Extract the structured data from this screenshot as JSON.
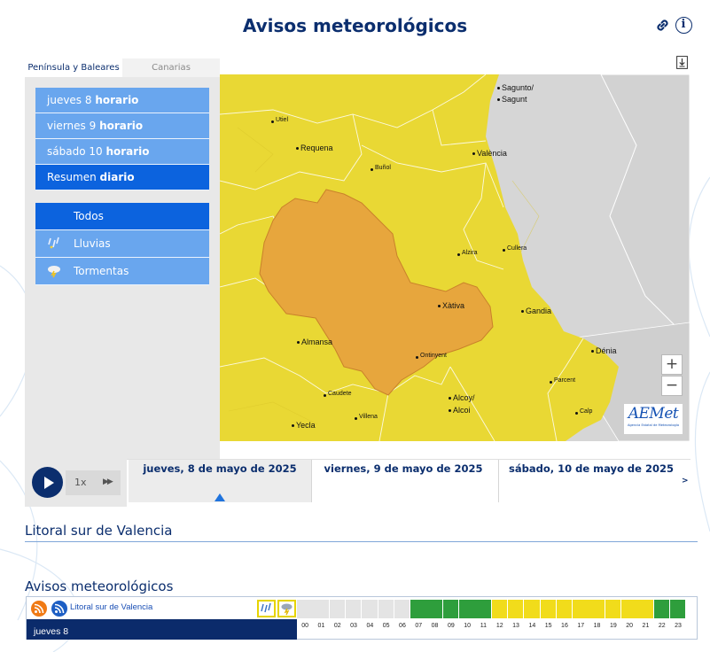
{
  "header": {
    "title": "Avisos meteorológicos",
    "link_icon": "link-icon",
    "info_icon": "info-icon",
    "info_glyph": "i"
  },
  "tabs": [
    {
      "label": "Península y Baleares",
      "active": true
    },
    {
      "label": "Canarias",
      "active": false
    }
  ],
  "days": [
    {
      "prefix": "jueves 8",
      "bold": "horario",
      "selected": false
    },
    {
      "prefix": "viernes 9",
      "bold": "horario",
      "selected": false
    },
    {
      "prefix": "sábado 10",
      "bold": "horario",
      "selected": false
    },
    {
      "prefix": "Resumen",
      "bold": "diario",
      "selected": true
    }
  ],
  "categories": [
    {
      "label": "Todos",
      "icon": "",
      "selected": true
    },
    {
      "label": "Lluvias",
      "icon": "rain-icon",
      "selected": false
    },
    {
      "label": "Tormentas",
      "icon": "storm-icon",
      "selected": false
    }
  ],
  "map": {
    "colors": {
      "yellow": "#e9d834",
      "orange": "#e7a63d",
      "sea": "#d6d6d6",
      "land_other": "#d4d4d4"
    },
    "cities": [
      "Sagunto/",
      "Sagunt",
      "Utiel",
      "Requena",
      "Buñol",
      "València",
      "Alzira",
      "Cullera",
      "Xàtiva",
      "Gandia",
      "Almansa",
      "Ontinyent",
      "Dénia",
      "Parcent",
      "Caudete",
      "Alcoy/",
      "Alcoi",
      "Villena",
      "Calp",
      "Yecla"
    ],
    "zoom_in": "+",
    "zoom_out": "−",
    "logo_text": "AEMet",
    "logo_subtext": "Agencia Estatal de Meteorología"
  },
  "player": {
    "speed": "1x",
    "ff_glyph": "▶▶"
  },
  "timeline": {
    "prev": "<",
    "next": ">",
    "days": [
      {
        "label": "jueves, 8 de mayo de 2025",
        "active": true
      },
      {
        "label": "viernes, 9 de mayo de 2025",
        "active": false
      },
      {
        "label": "sábado, 10 de mayo de 2025",
        "active": false
      }
    ]
  },
  "zone": {
    "title": "Litoral sur de Valencia"
  },
  "avisos": {
    "title": "Avisos meteorológicos",
    "zone_link": "Litoral sur de Valencia",
    "day_label": "jueves 8",
    "hours": [
      "00",
      "01",
      "02",
      "03",
      "04",
      "05",
      "06",
      "07",
      "08",
      "09",
      "10",
      "11",
      "12",
      "13",
      "14",
      "15",
      "16",
      "17",
      "18",
      "19",
      "20",
      "21",
      "22",
      "23"
    ],
    "hour_levels": [
      "none",
      "none",
      "none",
      "none",
      "none",
      "none",
      "none",
      "green",
      "green",
      "green",
      "green",
      "green",
      "yellow",
      "yellow",
      "yellow",
      "yellow",
      "yellow",
      "yellow",
      "yellow",
      "yellow",
      "yellow",
      "yellow",
      "green",
      "green"
    ],
    "level_colors": {
      "none": "#e4e4e4",
      "green": "#2e9e3c",
      "yellow": "#f1dc1b"
    }
  }
}
